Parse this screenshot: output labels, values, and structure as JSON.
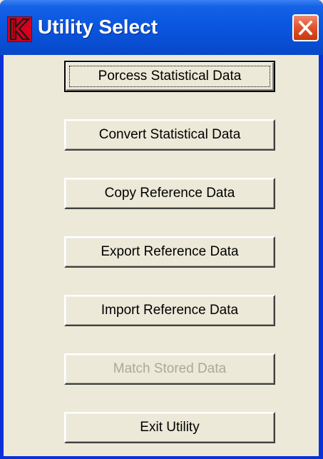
{
  "window": {
    "title": "Utility Select",
    "app_icon": "k-logo-icon",
    "close_icon": "close-icon"
  },
  "buttons": [
    {
      "label": "Porcess Statistical Data",
      "state": "default-focused"
    },
    {
      "label": "Convert Statistical Data",
      "state": "enabled"
    },
    {
      "label": "Copy Reference Data",
      "state": "enabled"
    },
    {
      "label": "Export Reference Data",
      "state": "enabled"
    },
    {
      "label": "Import Reference Data",
      "state": "enabled"
    },
    {
      "label": "Match Stored Data",
      "state": "disabled"
    },
    {
      "label": "Exit Utility",
      "state": "enabled"
    }
  ],
  "colors": {
    "titlebar": "#0b58e1",
    "face": "#ece9d8",
    "close": "#e2552f",
    "disabled_text": "#aca899",
    "icon_red": "#d6001c"
  }
}
